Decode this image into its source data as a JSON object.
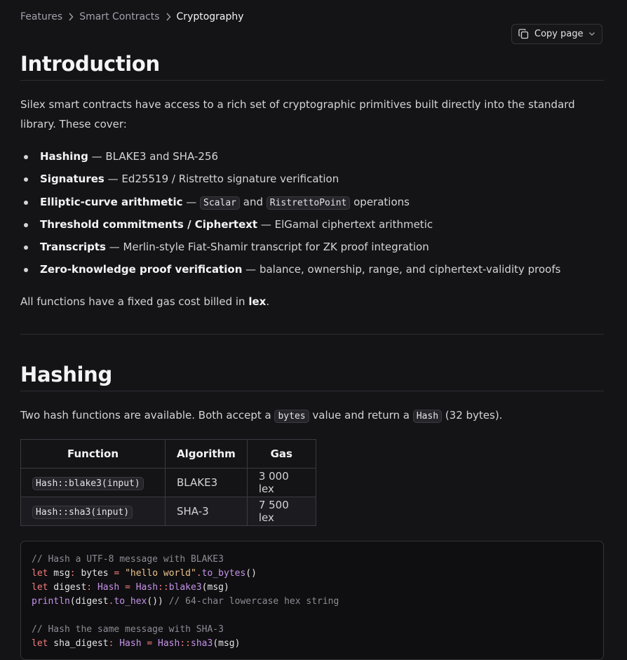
{
  "breadcrumb": {
    "items": [
      "Features",
      "Smart Contracts",
      "Cryptography"
    ]
  },
  "copy_button": {
    "label": "Copy page"
  },
  "intro": {
    "heading": "Introduction",
    "paragraph": "Silex smart contracts have access to a rich set of cryptographic primitives built directly into the standard library. These cover:",
    "bullets": [
      {
        "term": "Hashing",
        "sep": " — ",
        "parts": [
          {
            "t": "BLAKE3 and SHA-256"
          }
        ]
      },
      {
        "term": "Signatures",
        "sep": " — ",
        "parts": [
          {
            "t": "Ed25519 / Ristretto signature verification"
          }
        ]
      },
      {
        "term": "Elliptic-curve arithmetic",
        "sep": " — ",
        "parts": [
          {
            "c": "Scalar"
          },
          {
            "t": " and "
          },
          {
            "c": "RistrettoPoint"
          },
          {
            "t": " operations"
          }
        ]
      },
      {
        "term": "Threshold commitments / Ciphertext",
        "sep": " — ",
        "parts": [
          {
            "t": "ElGamal ciphertext arithmetic"
          }
        ]
      },
      {
        "term": "Transcripts",
        "sep": " — ",
        "parts": [
          {
            "t": "Merlin-style Fiat-Shamir transcript for ZK proof integration"
          }
        ]
      },
      {
        "term": "Zero-knowledge proof verification",
        "sep": " — ",
        "parts": [
          {
            "t": "balance, ownership, range, and ciphertext-validity proofs"
          }
        ]
      }
    ],
    "gas_note_prefix": "All functions have a fixed gas cost billed in ",
    "gas_note_unit": "lex",
    "gas_note_suffix": "."
  },
  "hashing": {
    "heading": "Hashing",
    "desc_1": "Two hash functions are available. Both accept a ",
    "desc_code_1": "bytes",
    "desc_2": " value and return a ",
    "desc_code_2": "Hash",
    "desc_3": " (32 bytes).",
    "table": {
      "headers": [
        "Function",
        "Algorithm",
        "Gas"
      ],
      "rows": [
        [
          "Hash::blake3(input)",
          "BLAKE3",
          "3 000 lex"
        ],
        [
          "Hash::sha3(input)",
          "SHA-3",
          "7 500 lex"
        ]
      ]
    },
    "code": [
      [
        {
          "k": "comment",
          "t": "// Hash a UTF-8 message with BLAKE3"
        }
      ],
      [
        {
          "k": "kw",
          "t": "let"
        },
        {
          "k": "plain",
          "t": " msg"
        },
        {
          "k": "op",
          "t": ":"
        },
        {
          "k": "plain",
          "t": " bytes "
        },
        {
          "k": "op",
          "t": "="
        },
        {
          "k": "plain",
          "t": " "
        },
        {
          "k": "str",
          "t": "\"hello world\""
        },
        {
          "k": "op",
          "t": "."
        },
        {
          "k": "fn",
          "t": "to_bytes"
        },
        {
          "k": "plain",
          "t": "()"
        }
      ],
      [
        {
          "k": "kw",
          "t": "let"
        },
        {
          "k": "plain",
          "t": " digest"
        },
        {
          "k": "op",
          "t": ":"
        },
        {
          "k": "plain",
          "t": " "
        },
        {
          "k": "type",
          "t": "Hash"
        },
        {
          "k": "plain",
          "t": " "
        },
        {
          "k": "op",
          "t": "="
        },
        {
          "k": "plain",
          "t": " "
        },
        {
          "k": "type",
          "t": "Hash"
        },
        {
          "k": "op",
          "t": "::"
        },
        {
          "k": "fn",
          "t": "blake3"
        },
        {
          "k": "plain",
          "t": "(msg)"
        }
      ],
      [
        {
          "k": "fn",
          "t": "println"
        },
        {
          "k": "plain",
          "t": "(digest"
        },
        {
          "k": "op",
          "t": "."
        },
        {
          "k": "fn",
          "t": "to_hex"
        },
        {
          "k": "plain",
          "t": "()) "
        },
        {
          "k": "comment",
          "t": "// 64-char lowercase hex string"
        }
      ],
      [],
      [
        {
          "k": "comment",
          "t": "// Hash the same message with SHA-3"
        }
      ],
      [
        {
          "k": "kw",
          "t": "let"
        },
        {
          "k": "plain",
          "t": " sha_digest"
        },
        {
          "k": "op",
          "t": ":"
        },
        {
          "k": "plain",
          "t": " "
        },
        {
          "k": "type",
          "t": "Hash"
        },
        {
          "k": "plain",
          "t": " "
        },
        {
          "k": "op",
          "t": "="
        },
        {
          "k": "plain",
          "t": " "
        },
        {
          "k": "type",
          "t": "Hash"
        },
        {
          "k": "op",
          "t": "::"
        },
        {
          "k": "fn",
          "t": "sha3"
        },
        {
          "k": "plain",
          "t": "(msg)"
        }
      ]
    ]
  }
}
